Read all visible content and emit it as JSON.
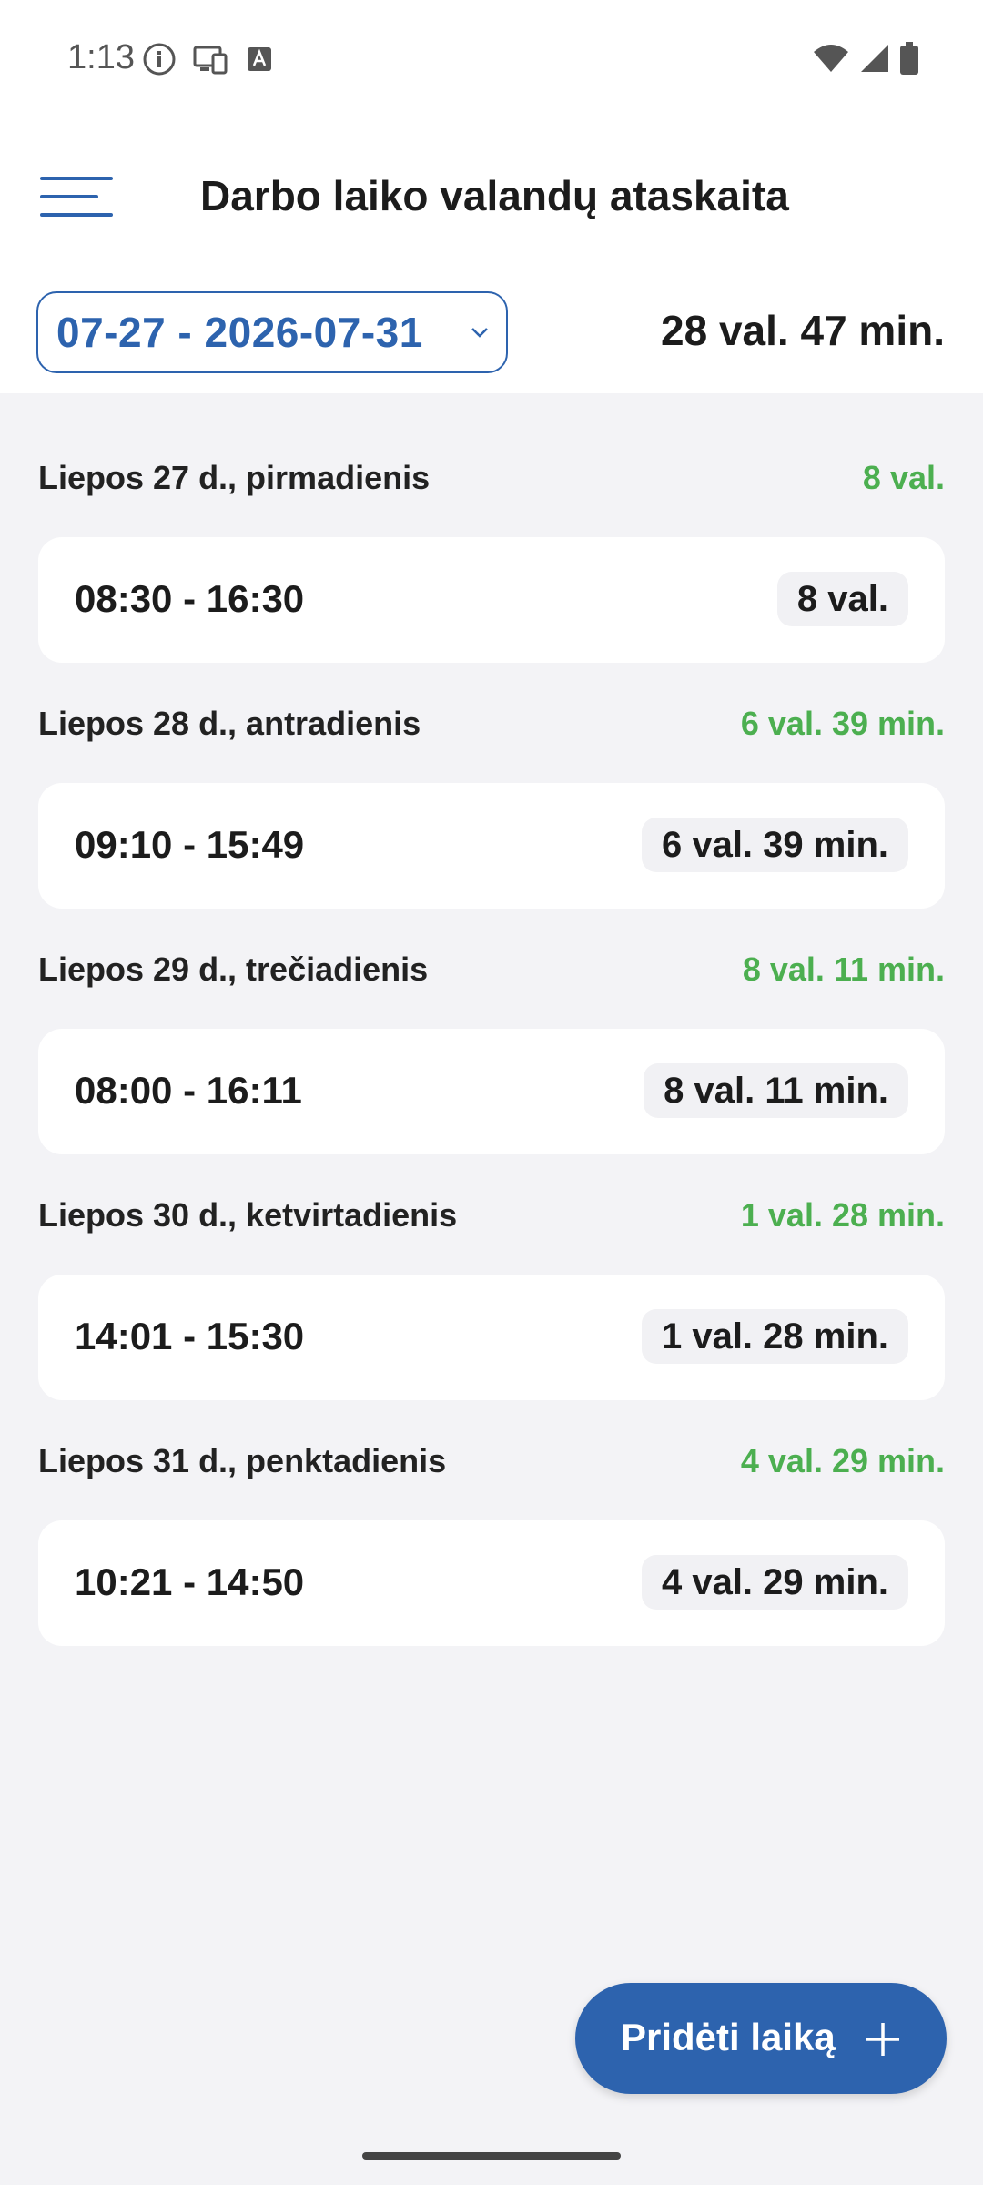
{
  "status_bar": {
    "time": "1:13",
    "left_icons": [
      "info-icon",
      "cast-icon",
      "keyboard-icon"
    ],
    "right_icons": [
      "wifi-icon",
      "signal-icon",
      "battery-icon"
    ]
  },
  "app_bar": {
    "menu_icon": "hamburger-menu-icon",
    "title": "Darbo laiko valandų ataskaita"
  },
  "filter": {
    "date_range": "07-27 - 2026-07-31",
    "total": "28 val. 47 min."
  },
  "days": [
    {
      "label": "Liepos 27 d., pirmadienis",
      "total": "8 val.",
      "entry": {
        "time": "08:30 - 16:30",
        "duration": "8 val."
      }
    },
    {
      "label": "Liepos 28 d., antradienis",
      "total": "6 val. 39 min.",
      "entry": {
        "time": "09:10 - 15:49",
        "duration": "6 val. 39 min."
      }
    },
    {
      "label": "Liepos 29 d., trečiadienis",
      "total": "8 val. 11 min.",
      "entry": {
        "time": "08:00 - 16:11",
        "duration": "8 val. 11 min."
      }
    },
    {
      "label": "Liepos 30 d., ketvirtadienis",
      "total": "1 val. 28 min.",
      "entry": {
        "time": "14:01 - 15:30",
        "duration": "1 val. 28 min."
      }
    },
    {
      "label": "Liepos 31 d., penktadienis",
      "total": "4 val. 29 min.",
      "entry": {
        "time": "10:21 - 14:50",
        "duration": "4 val. 29 min."
      }
    }
  ],
  "fab": {
    "label": "Pridėti laiką",
    "icon": "plus-icon"
  },
  "colors": {
    "accent": "#2d63ae",
    "positive": "#4caf50",
    "background": "#f3f3f6",
    "card": "#ffffff"
  }
}
